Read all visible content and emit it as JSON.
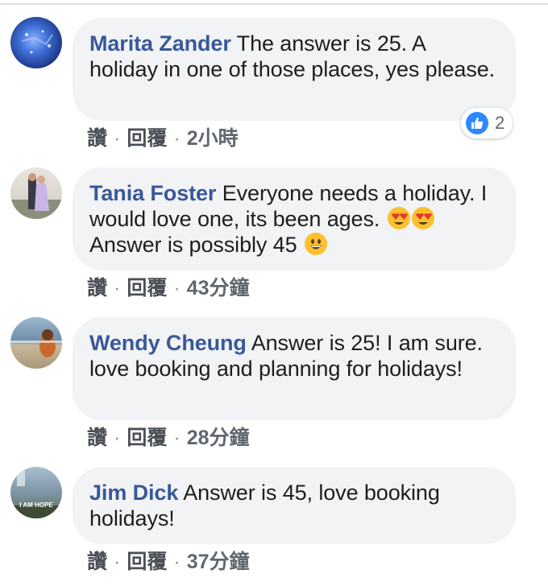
{
  "comments": [
    {
      "author": "Marita Zander",
      "text": "The answer is 25. A holiday in one of those places, yes please.",
      "like": "讚",
      "dot1": "·",
      "reply": "回覆",
      "dot2": "·",
      "time": "2小時",
      "reactions": {
        "icon": "thumbs-up-icon",
        "count": "2"
      }
    },
    {
      "author": "Tania Foster",
      "text": "Everyone needs a holiday. I would love one, its been ages.",
      "text2": "Answer is possibly 45",
      "like": "讚",
      "dot1": "·",
      "reply": "回覆",
      "dot2": "·",
      "time": "43分鐘"
    },
    {
      "author": "Wendy Cheung",
      "text": "Answer is 25! I am sure. love booking and planning for holidays!",
      "like": "讚",
      "dot1": "·",
      "reply": "回覆",
      "dot2": "·",
      "time": "28分鐘"
    },
    {
      "author": "Jim Dick",
      "text": "Answer is 45, love booking holidays!",
      "like": "讚",
      "dot1": "·",
      "reply": "回覆",
      "dot2": "·",
      "time": "37分鐘",
      "avatar_text": "I AM HOPE"
    }
  ],
  "colors": {
    "author": "#385898",
    "bubble": "#f2f3f5",
    "like_blue": "#2d88ff"
  }
}
